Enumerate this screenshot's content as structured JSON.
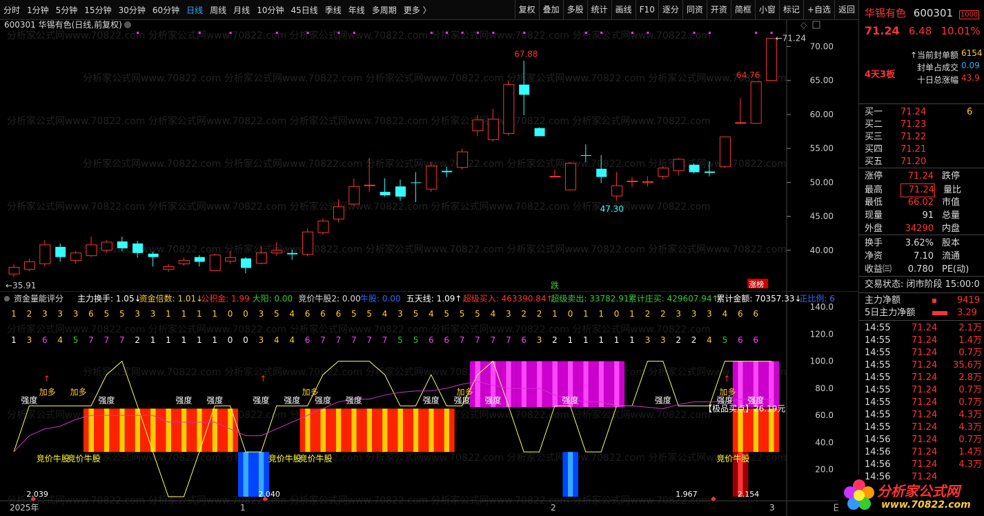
{
  "toolbar": {
    "timeframes": [
      "分时",
      "1分钟",
      "5分钟",
      "15分钟",
      "30分钟",
      "60分钟",
      "日线",
      "周线",
      "月线",
      "10分钟",
      "45日线",
      "季线",
      "年线",
      "多周期",
      "更多 〉"
    ],
    "active": "日线",
    "right_buttons": [
      "复权",
      "叠加",
      "多股",
      "统计",
      "画线",
      "F10",
      "逐分",
      "同资",
      "开资",
      "简框",
      "小窗",
      "标记",
      "+自选",
      "返回"
    ]
  },
  "main_chart": {
    "title": "600301 华锡有色(日线,前复权)",
    "watermark": "分析家公式网www.70822.com",
    "y_ticks": [
      "70.00",
      "65.00",
      "60.00",
      "55.00",
      "50.00",
      "45.00",
      "40.00"
    ],
    "labels": {
      "high": "67.88",
      "low": "47.30",
      "start": "←35.91",
      "last": "←71.24",
      "mid": "64.76"
    },
    "markers": {
      "die": "跌",
      "zhangting": "涨榜"
    }
  },
  "chart_data": {
    "type": "candlestick",
    "ylim": [
      35,
      73
    ],
    "candles": [
      [
        36.5,
        37.5,
        38.0,
        36.0
      ],
      [
        37.2,
        38.3,
        38.8,
        36.9
      ],
      [
        38.0,
        40.8,
        41.5,
        37.6
      ],
      [
        40.5,
        39.0,
        41.0,
        38.3
      ],
      [
        38.5,
        39.6,
        39.9,
        38.0
      ],
      [
        39.2,
        40.8,
        42.0,
        39.0
      ],
      [
        40.0,
        41.2,
        41.5,
        39.7
      ],
      [
        41.3,
        40.3,
        42.0,
        39.8
      ],
      [
        41.0,
        39.6,
        41.4,
        38.9
      ],
      [
        39.5,
        39.0,
        39.8,
        37.6
      ],
      [
        37.2,
        37.6,
        38.0,
        36.8
      ],
      [
        38.0,
        38.5,
        38.9,
        37.7
      ],
      [
        39.0,
        38.3,
        39.3,
        37.6
      ],
      [
        37.0,
        39.3,
        39.5,
        36.9
      ],
      [
        38.4,
        38.9,
        39.9,
        38.0
      ],
      [
        38.8,
        37.4,
        39.0,
        36.6
      ],
      [
        38.1,
        39.6,
        40.6,
        37.9
      ],
      [
        39.6,
        40.0,
        41.2,
        39.2
      ],
      [
        39.6,
        39.4,
        40.1,
        38.6
      ],
      [
        39.4,
        42.7,
        43.2,
        39.1
      ],
      [
        42.6,
        44.3,
        44.7,
        42.3
      ],
      [
        44.6,
        46.4,
        47.5,
        44.1
      ],
      [
        46.8,
        49.4,
        50.6,
        46.5
      ],
      [
        49.6,
        49.6,
        53.6,
        48.6
      ],
      [
        48.6,
        48.1,
        50.6,
        47.9
      ],
      [
        49.4,
        47.9,
        50.4,
        47.3
      ],
      [
        50.0,
        49.9,
        51.5,
        47.1
      ],
      [
        49.0,
        52.4,
        53.0,
        48.6
      ],
      [
        51.7,
        51.5,
        52.3,
        50.8
      ],
      [
        52.2,
        54.5,
        55.0,
        51.9
      ],
      [
        57.6,
        59.2,
        59.9,
        56.8
      ],
      [
        56.3,
        59.3,
        60.8,
        56.0
      ],
      [
        57.2,
        64.4,
        65.0,
        56.9
      ],
      [
        64.4,
        62.9,
        67.9,
        59.9
      ],
      [
        58.0,
        56.8,
        58.1,
        56.8
      ],
      [
        50.9,
        50.9,
        51.9,
        50.8
      ],
      [
        48.9,
        52.8,
        53.0,
        48.8
      ],
      [
        54.0,
        53.9,
        55.6,
        53.0
      ],
      [
        52.0,
        50.8,
        54.0,
        49.9
      ],
      [
        48.0,
        49.5,
        51.5,
        47.3
      ],
      [
        50.2,
        50.2,
        50.8,
        49.3
      ],
      [
        50.1,
        50.1,
        50.9,
        49.4
      ],
      [
        50.9,
        52.1,
        52.4,
        50.4
      ],
      [
        51.7,
        53.4,
        53.6,
        51.0
      ],
      [
        52.6,
        51.5,
        52.8,
        51.3
      ],
      [
        51.6,
        51.4,
        53.1,
        50.9
      ],
      [
        52.3,
        56.7,
        56.7,
        52.1
      ],
      [
        58.8,
        58.8,
        62.4,
        58.6
      ],
      [
        58.7,
        64.8,
        64.8,
        58.6
      ],
      [
        65.0,
        71.2,
        71.2,
        64.9
      ]
    ]
  },
  "indicator": {
    "title": "资金量能评分",
    "legend": [
      {
        "text": "主力换手: 1.05↓",
        "color": "#ffffff"
      },
      {
        "text": "资金倍数: 1.01↓",
        "color": "#ffcc33"
      },
      {
        "text": "公积金: 1.99",
        "color": "#ff3333"
      },
      {
        "text": "大阳: 0.00",
        "color": "#33cc33"
      },
      {
        "text": "竞价牛股2: 0.00",
        "color": "#dddddd"
      },
      {
        "text": "牛股: 0.00",
        "color": "#3366ff"
      },
      {
        "text": "五天线: 1.09↑",
        "color": "#ffffff"
      },
      {
        "text": "超级买入: 463390.84↑",
        "color": "#ff3333"
      },
      {
        "text": "超级卖出: 33782.91",
        "color": "#33cc33"
      },
      {
        "text": "累计庄买: 429607.94↑",
        "color": "#33cc33"
      },
      {
        "text": "累计金额: 70357.33↓",
        "color": "#ffffff"
      },
      {
        "text": "正比例: 6",
        "color": "#3366ff"
      }
    ],
    "y_ticks": [
      "140.0",
      "120.0",
      "100.0",
      "80.0",
      "60.0",
      "40.0",
      "20.0"
    ],
    "row1": [
      1,
      2,
      3,
      3,
      3,
      6,
      5,
      5,
      3,
      3,
      1,
      1,
      1,
      1,
      0,
      0,
      3,
      5,
      4,
      6,
      6,
      6,
      5,
      5,
      4,
      3,
      5,
      4,
      5,
      5,
      5,
      4,
      3,
      2,
      2,
      1,
      0,
      1,
      1,
      0,
      1,
      2,
      2,
      3,
      3,
      3,
      4,
      6,
      6
    ],
    "row2": [
      1,
      3,
      6,
      4,
      5,
      7,
      7,
      7,
      2,
      1,
      1,
      1,
      1,
      1,
      0,
      0,
      3,
      4,
      4,
      6,
      7,
      7,
      7,
      7,
      7,
      5,
      5,
      6,
      6,
      7,
      7,
      7,
      7,
      6,
      3,
      2,
      1,
      1,
      1,
      1,
      1,
      3,
      3,
      2,
      2,
      4,
      5,
      6,
      6
    ],
    "texts": {
      "qiangdu": "强度",
      "jiaduo": "加多",
      "jingjia": "竞价牛股",
      "jiduan": "【极品买点】26.19元"
    },
    "bottom_values": [
      "2.039",
      "2.040",
      "1.967",
      "2.154"
    ],
    "x_labels": [
      "2025年",
      "1",
      "2",
      "3",
      "日"
    ]
  },
  "quote": {
    "name": "华锡有色",
    "code": "600301",
    "price": "71.24",
    "change": "6.48",
    "pct": "10.01%",
    "board": "4天3板",
    "seal_info": [
      {
        "label": "当前封单额",
        "value": "6154"
      },
      {
        "label": "封单占成交",
        "value": "0.09"
      },
      {
        "label": "十日总涨幅",
        "value": "43.9"
      }
    ],
    "bids": [
      {
        "label": "买一",
        "price": "71.24",
        "vol": "6"
      },
      {
        "label": "买二",
        "price": "71.23",
        "vol": ""
      },
      {
        "label": "买三",
        "price": "71.22",
        "vol": ""
      },
      {
        "label": "买四",
        "price": "71.21",
        "vol": ""
      },
      {
        "label": "买五",
        "price": "71.20",
        "vol": ""
      }
    ],
    "stats": [
      {
        "l1": "涨停",
        "v1": "71.24",
        "l2": "跌停"
      },
      {
        "l1": "最高",
        "v1": "71.24",
        "l2": "量比"
      },
      {
        "l1": "最低",
        "v1": "66.02",
        "l2": "市值"
      },
      {
        "l1": "现量",
        "v1": "91",
        "l2": "总量"
      },
      {
        "l1": "外盘",
        "v1": "34290",
        "l2": "内盘"
      }
    ],
    "stats2": [
      {
        "l1": "换手",
        "v1": "3.62%",
        "l2": "股本"
      },
      {
        "l1": "净资",
        "v1": "7.10",
        "l2": "流通"
      },
      {
        "l1": "收益㈢",
        "v1": "0.780",
        "l2": "PE(动)"
      }
    ],
    "status": "交易状态: 闭市阶段 15:00:0",
    "flow": [
      {
        "label": "主力净额",
        "value": "9419"
      },
      {
        "label": "5日主力净额",
        "value": "3.29"
      }
    ],
    "ticks": [
      [
        "14:55",
        "71.24",
        "2.1万"
      ],
      [
        "14:55",
        "71.24",
        "1.4万"
      ],
      [
        "14:55",
        "71.24",
        "0.7万"
      ],
      [
        "14:55",
        "71.24",
        "35.6万"
      ],
      [
        "14:55",
        "71.24",
        "2.8万"
      ],
      [
        "14:55",
        "71.24",
        "0.7万"
      ],
      [
        "14:55",
        "71.24",
        "0.7万"
      ],
      [
        "14:55",
        "71.24",
        "4.3万"
      ],
      [
        "14:55",
        "71.24",
        "4.3万"
      ],
      [
        "14:56",
        "71.24",
        "0.7万"
      ],
      [
        "14:56",
        "71.24",
        "1.4万"
      ],
      [
        "14:56",
        "71.24",
        "4.3万"
      ],
      [
        "14:56",
        "71.24",
        ""
      ]
    ],
    "logo": "分析家公式网",
    "logo_url": "www.70822.com"
  }
}
